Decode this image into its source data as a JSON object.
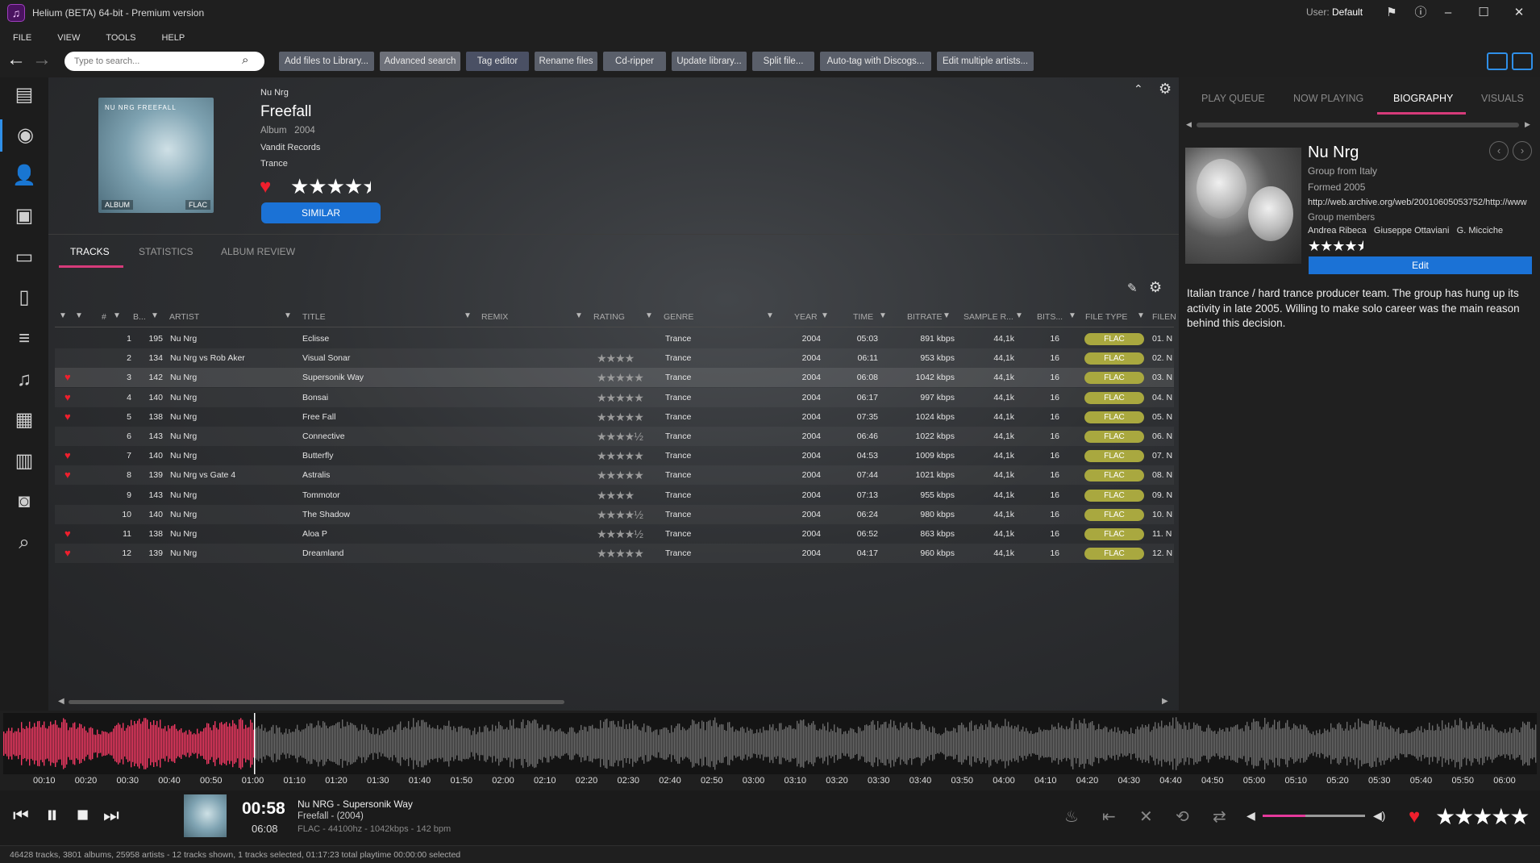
{
  "window": {
    "title": "Helium (BETA) 64-bit - Premium version",
    "user_label": "User:",
    "user_name": "Default"
  },
  "menu": [
    "FILE",
    "VIEW",
    "TOOLS",
    "HELP"
  ],
  "search": {
    "placeholder": "Type to search..."
  },
  "toolbar": [
    "Add files to Library...",
    "Advanced search",
    "Tag editor",
    "Rename files",
    "Cd-ripper",
    "Update library...",
    "Split file...",
    "Auto-tag with Discogs...",
    "Edit multiple artists..."
  ],
  "album": {
    "artist": "Nu Nrg",
    "title": "Freefall",
    "meta": "Album   2004",
    "label": "Vandit Records",
    "genre": "Trance",
    "rating": 4.5,
    "loved": true,
    "similar_label": "SIMILAR",
    "cover_label": "NU NRG FREEFALL",
    "cover_badge_left": "ALBUM",
    "cover_badge_right": "FLAC"
  },
  "tabs": [
    "TRACKS",
    "STATISTICS",
    "ALBUM REVIEW"
  ],
  "columns": [
    "#",
    "B...",
    "ARTIST",
    "TITLE",
    "REMIX",
    "RATING",
    "GENRE",
    "YEAR",
    "TIME",
    "BITRATE",
    "SAMPLE R...",
    "BITS...",
    "FILE TYPE",
    "FILEN"
  ],
  "tracks": [
    {
      "loved": false,
      "num": "1",
      "bpm": "195",
      "artist": "Nu Nrg",
      "title": "Eclisse",
      "stars": "",
      "genre": "Trance",
      "year": "2004",
      "time": "05:03",
      "bitrate": "891 kbps",
      "sample": "44,1k",
      "bits": "16",
      "type": "FLAC",
      "file": "01. N"
    },
    {
      "loved": false,
      "num": "2",
      "bpm": "134",
      "artist": "Nu Nrg vs Rob Aker",
      "title": "Visual Sonar",
      "stars": "★★★★",
      "genre": "Trance",
      "year": "2004",
      "time": "06:11",
      "bitrate": "953 kbps",
      "sample": "44,1k",
      "bits": "16",
      "type": "FLAC",
      "file": "02. N"
    },
    {
      "loved": true,
      "num": "3",
      "bpm": "142",
      "artist": "Nu Nrg",
      "title": "Supersonik Way",
      "stars": "★★★★★",
      "genre": "Trance",
      "year": "2004",
      "time": "06:08",
      "bitrate": "1042 kbps",
      "sample": "44,1k",
      "bits": "16",
      "type": "FLAC",
      "file": "03. N"
    },
    {
      "loved": true,
      "num": "4",
      "bpm": "140",
      "artist": "Nu Nrg",
      "title": "Bonsai",
      "stars": "★★★★★",
      "genre": "Trance",
      "year": "2004",
      "time": "06:17",
      "bitrate": "997 kbps",
      "sample": "44,1k",
      "bits": "16",
      "type": "FLAC",
      "file": "04. N"
    },
    {
      "loved": true,
      "num": "5",
      "bpm": "138",
      "artist": "Nu Nrg",
      "title": "Free Fall",
      "stars": "★★★★★",
      "genre": "Trance",
      "year": "2004",
      "time": "07:35",
      "bitrate": "1024 kbps",
      "sample": "44,1k",
      "bits": "16",
      "type": "FLAC",
      "file": "05. N"
    },
    {
      "loved": false,
      "num": "6",
      "bpm": "143",
      "artist": "Nu Nrg",
      "title": "Connective",
      "stars": "★★★★½",
      "genre": "Trance",
      "year": "2004",
      "time": "06:46",
      "bitrate": "1022 kbps",
      "sample": "44,1k",
      "bits": "16",
      "type": "FLAC",
      "file": "06. N"
    },
    {
      "loved": true,
      "num": "7",
      "bpm": "140",
      "artist": "Nu Nrg",
      "title": "Butterfly",
      "stars": "★★★★★",
      "genre": "Trance",
      "year": "2004",
      "time": "04:53",
      "bitrate": "1009 kbps",
      "sample": "44,1k",
      "bits": "16",
      "type": "FLAC",
      "file": "07. N"
    },
    {
      "loved": true,
      "num": "8",
      "bpm": "139",
      "artist": "Nu Nrg vs Gate 4",
      "title": "Astralis",
      "stars": "★★★★★",
      "genre": "Trance",
      "year": "2004",
      "time": "07:44",
      "bitrate": "1021 kbps",
      "sample": "44,1k",
      "bits": "16",
      "type": "FLAC",
      "file": "08. N"
    },
    {
      "loved": false,
      "num": "9",
      "bpm": "143",
      "artist": "Nu Nrg",
      "title": "Tommotor",
      "stars": "★★★★",
      "genre": "Trance",
      "year": "2004",
      "time": "07:13",
      "bitrate": "955 kbps",
      "sample": "44,1k",
      "bits": "16",
      "type": "FLAC",
      "file": "09. N"
    },
    {
      "loved": false,
      "num": "10",
      "bpm": "140",
      "artist": "Nu Nrg",
      "title": "The Shadow",
      "stars": "★★★★½",
      "genre": "Trance",
      "year": "2004",
      "time": "06:24",
      "bitrate": "980 kbps",
      "sample": "44,1k",
      "bits": "16",
      "type": "FLAC",
      "file": "10. N"
    },
    {
      "loved": true,
      "num": "11",
      "bpm": "138",
      "artist": "Nu Nrg",
      "title": "Aloa P",
      "stars": "★★★★½",
      "genre": "Trance",
      "year": "2004",
      "time": "06:52",
      "bitrate": "863 kbps",
      "sample": "44,1k",
      "bits": "16",
      "type": "FLAC",
      "file": "11. N"
    },
    {
      "loved": true,
      "num": "12",
      "bpm": "139",
      "artist": "Nu Nrg",
      "title": "Dreamland",
      "stars": "★★★★★",
      "genre": "Trance",
      "year": "2004",
      "time": "04:17",
      "bitrate": "960 kbps",
      "sample": "44,1k",
      "bits": "16",
      "type": "FLAC",
      "file": "12. N"
    }
  ],
  "selected_track": 3,
  "right_tabs": [
    "PLAY QUEUE",
    "NOW PLAYING",
    "BIOGRAPHY",
    "VISUALS"
  ],
  "bio": {
    "name": "Nu Nrg",
    "origin": "Group from Italy",
    "formed": "Formed 2005",
    "url": "http://web.archive.org/web/20010605053752/http://www",
    "members_label": "Group members",
    "members": "Andrea Ribeca   Giuseppe Ottaviani   G. Micciche",
    "rating": 4.5,
    "edit_label": "Edit",
    "text": "Italian trance / hard trance producer team. The group has hung up its activity in late 2005. Willing to make solo career was the main reason behind this decision."
  },
  "timeline": [
    "00:10",
    "00:20",
    "00:30",
    "00:40",
    "00:50",
    "01:00",
    "01:10",
    "01:20",
    "01:30",
    "01:40",
    "01:50",
    "02:00",
    "02:10",
    "02:20",
    "02:30",
    "02:40",
    "02:50",
    "03:00",
    "03:10",
    "03:20",
    "03:30",
    "03:40",
    "03:50",
    "04:00",
    "04:10",
    "04:20",
    "04:30",
    "04:40",
    "04:50",
    "05:00",
    "05:10",
    "05:20",
    "05:30",
    "05:40",
    "05:50",
    "06:00"
  ],
  "now_playing": {
    "elapsed": "00:58",
    "total": "06:08",
    "title": "Nu NRG - Supersonik Way",
    "album": "Freefall - (2004)",
    "format": "FLAC - 44100hz - 1042kbps - 142 bpm",
    "progress": 0.158,
    "volume": 0.42,
    "loved": true,
    "rating": 5
  },
  "status": "46428 tracks, 3801 albums, 25958 artists - 12 tracks shown, 1 tracks selected, 01:17:23 total playtime 00:00:00 selected",
  "colors": {
    "accent": "#d63b7a",
    "blue": "#1b72d6",
    "love": "#ef1f2d",
    "flac": "#a9a83f",
    "wave_played": "#f03a63",
    "wave_rest": "#6b6b6b"
  }
}
